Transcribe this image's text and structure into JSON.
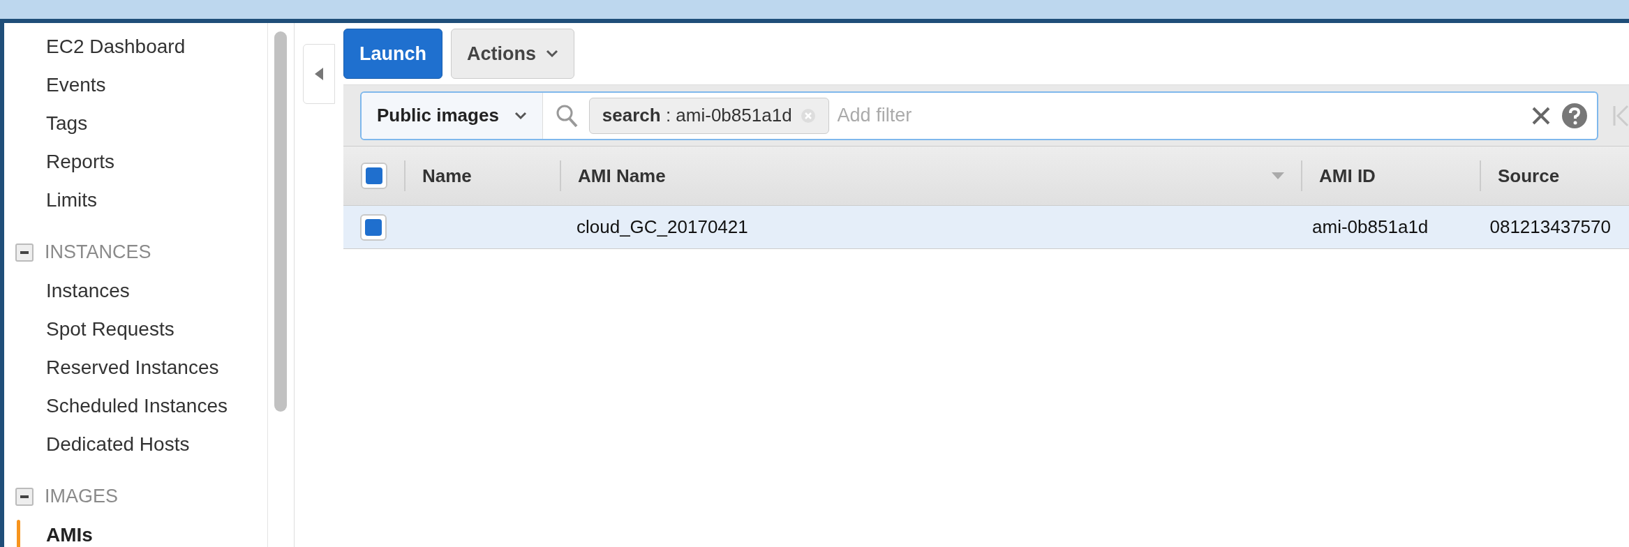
{
  "sidebar": {
    "items": [
      {
        "kind": "link",
        "label": "EC2 Dashboard",
        "selected": false
      },
      {
        "kind": "link",
        "label": "Events",
        "selected": false
      },
      {
        "kind": "link",
        "label": "Tags",
        "selected": false
      },
      {
        "kind": "link",
        "label": "Reports",
        "selected": false
      },
      {
        "kind": "link",
        "label": "Limits",
        "selected": false
      },
      {
        "kind": "section",
        "label": "INSTANCES",
        "expanded": true
      },
      {
        "kind": "link",
        "label": "Instances",
        "selected": false
      },
      {
        "kind": "link",
        "label": "Spot Requests",
        "selected": false
      },
      {
        "kind": "link",
        "label": "Reserved Instances",
        "selected": false
      },
      {
        "kind": "link",
        "label": "Scheduled Instances",
        "selected": false
      },
      {
        "kind": "link",
        "label": "Dedicated Hosts",
        "selected": false
      },
      {
        "kind": "section",
        "label": "IMAGES",
        "expanded": true
      },
      {
        "kind": "link",
        "label": "AMIs",
        "selected": true
      }
    ]
  },
  "toolbar": {
    "launch": "Launch",
    "actions": "Actions"
  },
  "filter": {
    "scope": "Public images",
    "token": "**search** : ami-0b851a1d",
    "placeholder": "Add filter"
  },
  "table": {
    "columns": [
      "Name",
      "AMI Name",
      "AMI ID",
      "Source"
    ],
    "all_checked": true,
    "rows": [
      {
        "selected": true,
        "checked": true,
        "cells": [
          "",
          "cloud_GC_20170421",
          "ami-0b851a1d",
          "081213437570"
        ]
      }
    ]
  }
}
